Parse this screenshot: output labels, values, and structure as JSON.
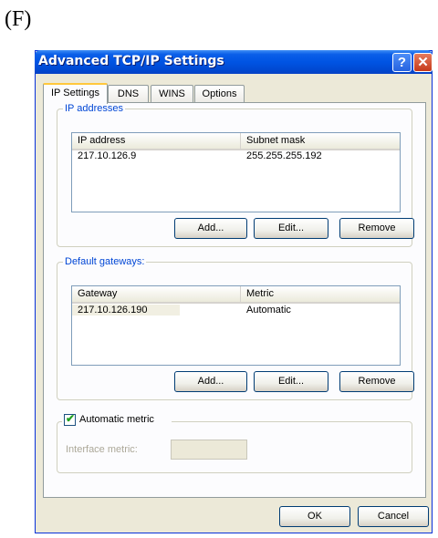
{
  "figure_label": "(F)",
  "window": {
    "title": "Advanced TCP/IP Settings",
    "help_glyph": "?",
    "close_glyph": "✕"
  },
  "tabs": [
    {
      "label": "IP Settings",
      "active": true
    },
    {
      "label": "DNS",
      "active": false
    },
    {
      "label": "WINS",
      "active": false
    },
    {
      "label": "Options",
      "active": false
    }
  ],
  "ip_addresses": {
    "legend": "IP addresses",
    "columns": [
      "IP address",
      "Subnet mask"
    ],
    "rows": [
      {
        "col1": "217.10.126.9",
        "col2": "255.255.255.192"
      }
    ],
    "buttons": {
      "add": "Add...",
      "edit": "Edit...",
      "remove": "Remove"
    }
  },
  "default_gateways": {
    "legend": "Default gateways:",
    "columns": [
      "Gateway",
      "Metric"
    ],
    "rows": [
      {
        "col1": "217.10.126.190",
        "col2": "Automatic"
      }
    ],
    "buttons": {
      "add": "Add...",
      "edit": "Edit...",
      "remove": "Remove"
    }
  },
  "automatic_metric": {
    "label": "Automatic metric",
    "checked": true,
    "interface_metric_label": "Interface metric:",
    "interface_metric_value": ""
  },
  "footer": {
    "ok": "OK",
    "cancel": "Cancel"
  }
}
